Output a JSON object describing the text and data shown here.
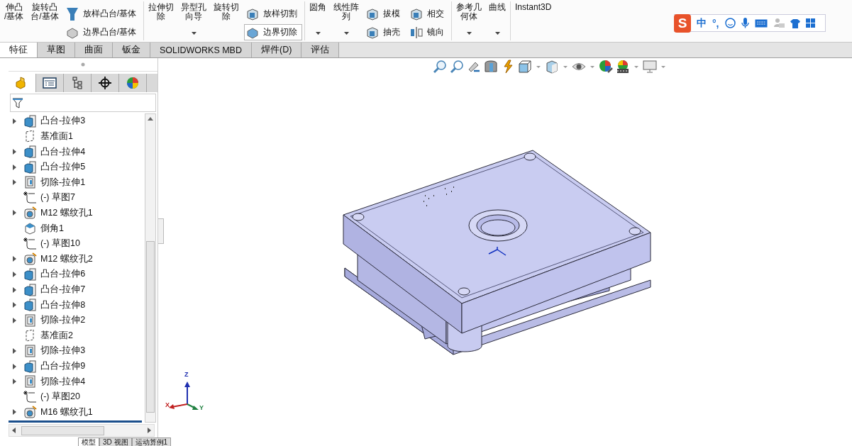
{
  "ribbon": {
    "groups": [
      {
        "items": [
          {
            "kind": "big",
            "lines": [
              "伸凸",
              "/基体"
            ],
            "caret": false
          },
          {
            "kind": "big",
            "lines": [
              "旋转凸",
              "台/基体"
            ],
            "caret": false
          },
          {
            "kind": "stack",
            "items": [
              {
                "label": "放样凸台/基体",
                "kind": "loft",
                "highlighted": false
              },
              {
                "label": "边界凸台/基体",
                "kind": "boundary",
                "highlighted": false
              }
            ]
          }
        ]
      },
      {
        "items": [
          {
            "kind": "big",
            "lines": [
              "拉伸切",
              "除"
            ],
            "caret": false
          },
          {
            "kind": "big",
            "lines": [
              "异型孔",
              "向导"
            ],
            "caret": true
          },
          {
            "kind": "big",
            "lines": [
              "旋转切",
              "除"
            ],
            "caret": false
          },
          {
            "kind": "stack",
            "items": [
              {
                "label": "放样切割",
                "kind": "cutloft",
                "highlighted": false
              },
              {
                "label": "边界切除",
                "kind": "boundary",
                "highlighted": true
              }
            ]
          }
        ]
      },
      {
        "items": [
          {
            "kind": "big",
            "lines": [
              "圆角"
            ],
            "caret": true
          },
          {
            "kind": "big",
            "lines": [
              "线性阵",
              "列"
            ],
            "caret": true
          },
          {
            "kind": "stack",
            "items": [
              {
                "label": "拔模",
                "kind": "draft",
                "highlighted": false
              },
              {
                "label": "抽壳",
                "kind": "shell",
                "highlighted": false
              }
            ]
          },
          {
            "kind": "stack",
            "items": [
              {
                "label": "相交",
                "kind": "intersect",
                "highlighted": false
              },
              {
                "label": "镜向",
                "kind": "mirror",
                "highlighted": false
              }
            ]
          }
        ]
      },
      {
        "items": [
          {
            "kind": "big",
            "lines": [
              "参考几",
              "何体"
            ],
            "caret": true
          },
          {
            "kind": "big",
            "lines": [
              "曲线"
            ],
            "caret": true
          }
        ]
      },
      {
        "items": [
          {
            "kind": "big",
            "lines": [
              "Instant3D"
            ],
            "caret": false
          }
        ]
      }
    ]
  },
  "ime": {
    "logo": "S",
    "items": [
      "中",
      "°,"
    ]
  },
  "tabs": [
    {
      "label": "特征",
      "selected": true
    },
    {
      "label": "草图",
      "selected": false
    },
    {
      "label": "曲面",
      "selected": false
    },
    {
      "label": "钣金",
      "selected": false
    },
    {
      "label": "SOLIDWORKS MBD",
      "selected": false
    },
    {
      "label": "焊件(D)",
      "selected": false
    },
    {
      "label": "评估",
      "selected": false
    }
  ],
  "feature_tree": [
    {
      "name": "凸台-拉伸3",
      "kind": "boss",
      "expandable": true
    },
    {
      "name": "基准面1",
      "kind": "plane",
      "expandable": false
    },
    {
      "name": "凸台-拉伸4",
      "kind": "boss",
      "expandable": true
    },
    {
      "name": "凸台-拉伸5",
      "kind": "boss",
      "expandable": true
    },
    {
      "name": "切除-拉伸1",
      "kind": "cut",
      "expandable": true
    },
    {
      "name": "(-) 草图7",
      "kind": "sketch",
      "expandable": false
    },
    {
      "name": "M12 螺纹孔1",
      "kind": "hole",
      "expandable": true
    },
    {
      "name": "倒角1",
      "kind": "chamfer",
      "expandable": false
    },
    {
      "name": "(-) 草图10",
      "kind": "sketch",
      "expandable": false
    },
    {
      "name": "M12 螺纹孔2",
      "kind": "hole",
      "expandable": true
    },
    {
      "name": "凸台-拉伸6",
      "kind": "boss",
      "expandable": true
    },
    {
      "name": "凸台-拉伸7",
      "kind": "boss",
      "expandable": true
    },
    {
      "name": "凸台-拉伸8",
      "kind": "boss",
      "expandable": true
    },
    {
      "name": "切除-拉伸2",
      "kind": "cut",
      "expandable": true
    },
    {
      "name": "基准面2",
      "kind": "plane",
      "expandable": false
    },
    {
      "name": "切除-拉伸3",
      "kind": "cut",
      "expandable": true
    },
    {
      "name": "凸台-拉伸9",
      "kind": "boss",
      "expandable": true
    },
    {
      "name": "切除-拉伸4",
      "kind": "cut",
      "expandable": true
    },
    {
      "name": "(-) 草图20",
      "kind": "sketch",
      "expandable": false
    },
    {
      "name": "M16 螺纹孔1",
      "kind": "hole",
      "expandable": true
    }
  ],
  "triad": {
    "x": "X",
    "y": "Y",
    "z": "Z"
  },
  "bottom_tabs": [
    {
      "label": "模型",
      "selected": true
    },
    {
      "label": "3D 视图",
      "selected": false
    },
    {
      "label": "运动算例1",
      "selected": false
    }
  ]
}
